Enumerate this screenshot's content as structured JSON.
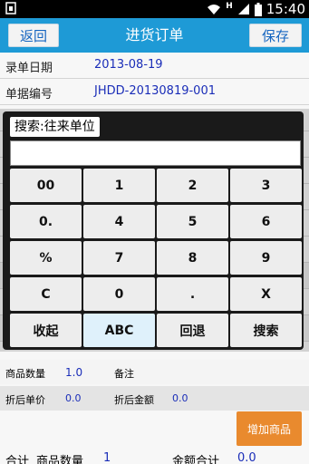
{
  "status_bar": {
    "time": "15:40",
    "network": "H"
  },
  "header": {
    "back_label": "返回",
    "title": "进货订单",
    "save_label": "保存"
  },
  "form": {
    "rows": [
      {
        "label": "录单日期",
        "value": "2013-08-19"
      },
      {
        "label": "单据编号",
        "value": "JHDD-20130819-001"
      }
    ]
  },
  "keypad": {
    "title": "搜索:往来单位",
    "input_value": "",
    "keys": [
      [
        "00",
        "1",
        "2",
        "3"
      ],
      [
        "0.",
        "4",
        "5",
        "6"
      ],
      [
        "%",
        "7",
        "8",
        "9"
      ],
      [
        "C",
        "0",
        ".",
        "X"
      ],
      [
        "收起",
        "ABC",
        "回退",
        "搜索"
      ]
    ]
  },
  "product": {
    "qty_label": "商品数量",
    "qty_value": "1.0",
    "note_label": "备注",
    "discount_price_label": "折后单价",
    "discount_price_value": "0.0",
    "discount_amount_label": "折后金额",
    "discount_amount_value": "0.0"
  },
  "add_product_label": "增加商品",
  "totals": {
    "label": "合计",
    "qty_label": "商品数量",
    "qty_value": "1",
    "amount_label": "金额合计",
    "amount_value": "0.0"
  },
  "colors": {
    "title_bar": "#1e9ad6",
    "value_text": "#1a2db8",
    "add_button": "#e98a2e"
  }
}
